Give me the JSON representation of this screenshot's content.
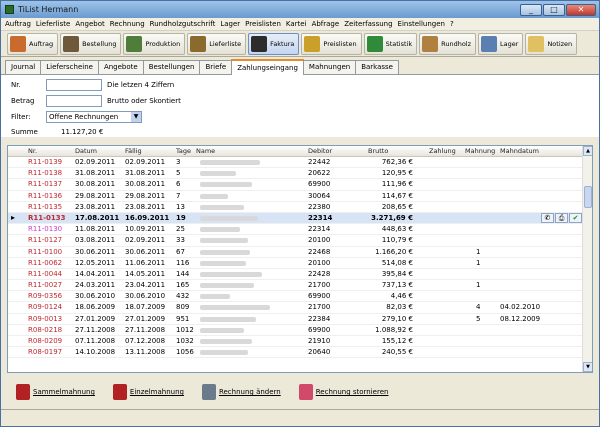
{
  "window": {
    "title": "TiList  Hermann"
  },
  "menu": [
    "Auftrag",
    "Lieferliste",
    "Angebot",
    "Rechnung",
    "Rundholzgutschrift",
    "Lager",
    "Preislisten",
    "Kartei",
    "Abfrage",
    "Zeiterfassung",
    "Einstellungen",
    "?"
  ],
  "toolbar": [
    {
      "label": "Auftrag",
      "color": "#c96b2e"
    },
    {
      "label": "Bestellung",
      "color": "#6e5a3a"
    },
    {
      "label": "Produktion",
      "color": "#4f7d3a"
    },
    {
      "label": "Lieferliste",
      "color": "#8a6a2d"
    },
    {
      "label": "Faktura",
      "color": "#2c2c2c",
      "active": true
    },
    {
      "label": "Preislisten",
      "color": "#caa02b"
    },
    {
      "label": "Statistik",
      "color": "#2f8a3a"
    },
    {
      "label": "Rundholz",
      "color": "#b08040"
    },
    {
      "label": "Lager",
      "color": "#5a7fb0"
    },
    {
      "label": "Notizen",
      "color": "#e0c060"
    }
  ],
  "tabs": [
    "Journal",
    "Lieferscheine",
    "Angebote",
    "Bestellungen",
    "Briefe",
    "Zahlungseingang",
    "Mahnungen",
    "Barkasse"
  ],
  "active_tab": "Zahlungseingang",
  "form": {
    "nr_label": "Nr.",
    "nr_hint": "Die letzen 4 Ziffern",
    "betrag_label": "Betrag",
    "betrag_hint": "Brutto oder Skontiert",
    "filter_label": "Filter:",
    "filter_value": "Offene Rechnungen",
    "summe_label": "Summe",
    "summe_value": "11.127,20 €"
  },
  "table": {
    "columns": [
      "Nr.",
      "Datum",
      "Fällig",
      "Tage",
      "Name",
      "Debitor",
      "Brutto",
      "Zahlung",
      "Mahnung",
      "Mahndatum"
    ],
    "rows": [
      {
        "nr": "R11-0139",
        "datum": "02.09.2011",
        "faellig": "02.09.2011",
        "tage": "3",
        "debitor": "22442",
        "brutto": "762,36 €",
        "mahnung": "",
        "mahndatum": ""
      },
      {
        "nr": "R11-0138",
        "datum": "31.08.2011",
        "faellig": "31.08.2011",
        "tage": "5",
        "debitor": "20622",
        "brutto": "120,95 €",
        "mahnung": "",
        "mahndatum": ""
      },
      {
        "nr": "R11-0137",
        "datum": "30.08.2011",
        "faellig": "30.08.2011",
        "tage": "6",
        "debitor": "69900",
        "brutto": "111,96 €",
        "mahnung": "",
        "mahndatum": ""
      },
      {
        "nr": "R11-0136",
        "datum": "29.08.2011",
        "faellig": "29.08.2011",
        "tage": "7",
        "debitor": "30064",
        "brutto": "114,67 €",
        "mahnung": "",
        "mahndatum": ""
      },
      {
        "nr": "R11-0135",
        "datum": "23.08.2011",
        "faellig": "23.08.2011",
        "tage": "13",
        "debitor": "22380",
        "brutto": "208,65 €",
        "mahnung": "",
        "mahndatum": ""
      },
      {
        "nr": "R11-0133",
        "datum": "17.08.2011",
        "faellig": "16.09.2011",
        "tage": "19",
        "debitor": "22314",
        "brutto": "3.271,69 €",
        "mahnung": "",
        "mahndatum": "",
        "selected": true
      },
      {
        "nr": "R11-0130",
        "datum": "11.08.2011",
        "faellig": "10.09.2011",
        "tage": "25",
        "debitor": "22314",
        "brutto": "448,63 €",
        "mahnung": "",
        "mahndatum": "",
        "pink": true
      },
      {
        "nr": "R11-0127",
        "datum": "03.08.2011",
        "faellig": "02.09.2011",
        "tage": "33",
        "debitor": "20100",
        "brutto": "110,79 €",
        "mahnung": "",
        "mahndatum": ""
      },
      {
        "nr": "R11-0100",
        "datum": "30.06.2011",
        "faellig": "30.06.2011",
        "tage": "67",
        "debitor": "22468",
        "brutto": "1.166,20 €",
        "mahnung": "1",
        "mahndatum": ""
      },
      {
        "nr": "R11-0062",
        "datum": "12.05.2011",
        "faellig": "11.06.2011",
        "tage": "116",
        "debitor": "20100",
        "brutto": "514,08 €",
        "mahnung": "1",
        "mahndatum": ""
      },
      {
        "nr": "R11-0044",
        "datum": "14.04.2011",
        "faellig": "14.05.2011",
        "tage": "144",
        "debitor": "22428",
        "brutto": "395,84 €",
        "mahnung": "",
        "mahndatum": ""
      },
      {
        "nr": "R11-0027",
        "datum": "24.03.2011",
        "faellig": "23.04.2011",
        "tage": "165",
        "debitor": "21700",
        "brutto": "737,13 €",
        "mahnung": "1",
        "mahndatum": ""
      },
      {
        "nr": "R09-0356",
        "datum": "30.06.2010",
        "faellig": "30.06.2010",
        "tage": "432",
        "debitor": "69900",
        "brutto": "4,46 €",
        "mahnung": "",
        "mahndatum": ""
      },
      {
        "nr": "R09-0124",
        "datum": "18.06.2009",
        "faellig": "18.07.2009",
        "tage": "809",
        "debitor": "21700",
        "brutto": "82,03 €",
        "mahnung": "4",
        "mahndatum": "04.02.2010"
      },
      {
        "nr": "R09-0013",
        "datum": "27.01.2009",
        "faellig": "27.01.2009",
        "tage": "951",
        "debitor": "22384",
        "brutto": "279,10 €",
        "mahnung": "5",
        "mahndatum": "08.12.2009"
      },
      {
        "nr": "R08-0218",
        "datum": "27.11.2008",
        "faellig": "27.11.2008",
        "tage": "1012",
        "debitor": "69900",
        "brutto": "1.088,92 €",
        "mahnung": "",
        "mahndatum": ""
      },
      {
        "nr": "R08-0209",
        "datum": "07.11.2008",
        "faellig": "07.12.2008",
        "tage": "1032",
        "debitor": "21910",
        "brutto": "155,12 €",
        "mahnung": "",
        "mahndatum": ""
      },
      {
        "nr": "R08-0197",
        "datum": "14.10.2008",
        "faellig": "13.11.2008",
        "tage": "1056",
        "debitor": "20640",
        "brutto": "240,55 €",
        "mahnung": "",
        "mahndatum": ""
      }
    ]
  },
  "bottom_buttons": [
    {
      "label": "Sammelmahnung",
      "icon": "sammelmahnung-icon"
    },
    {
      "label": "Einzelmahnung",
      "icon": "einzelmahnung-icon"
    },
    {
      "label": "Rechnung ändern",
      "icon": "edit-invoice-icon"
    },
    {
      "label": "Rechnung stornieren",
      "icon": "eraser-icon"
    }
  ]
}
